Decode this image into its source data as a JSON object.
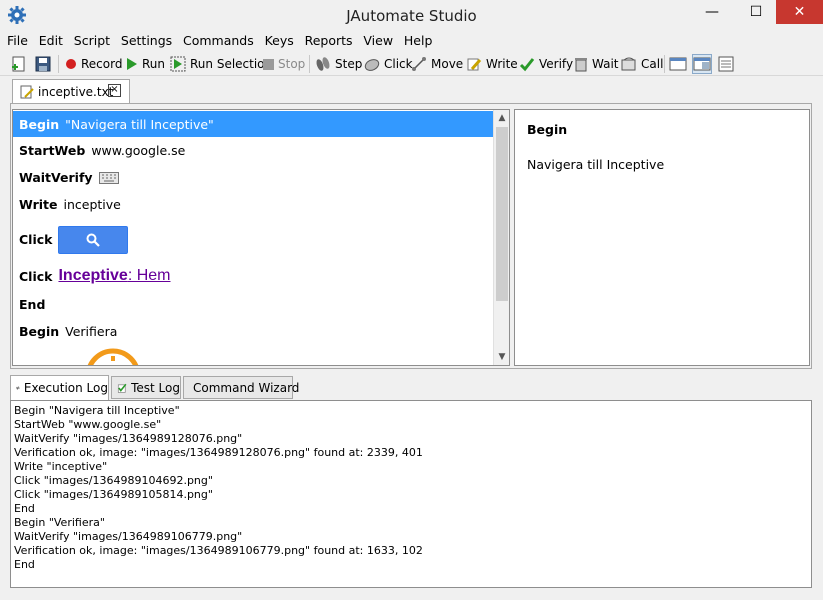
{
  "window": {
    "title": "JAutomate Studio",
    "minimize": "—",
    "maximize": "☐",
    "close": "✕"
  },
  "menu": [
    "File",
    "Edit",
    "Script",
    "Settings",
    "Commands",
    "Keys",
    "Reports",
    "View",
    "Help"
  ],
  "toolbar": {
    "record": "Record",
    "run": "Run",
    "run_selection": "Run Selection",
    "stop": "Stop",
    "step": "Step",
    "click": "Click",
    "move": "Move",
    "write": "Write",
    "verify": "Verify",
    "wait": "Wait",
    "call": "Call"
  },
  "file_tab": {
    "name": "inceptive.txt",
    "close": "×"
  },
  "script": {
    "lines": [
      {
        "keyword": "Begin",
        "arg": "\"Navigera till Inceptive\""
      },
      {
        "keyword": "StartWeb",
        "arg": "www.google.se"
      },
      {
        "keyword": "WaitVerify",
        "arg": ""
      },
      {
        "keyword": "Write",
        "arg": "inceptive"
      },
      {
        "keyword": "Click",
        "arg": ""
      },
      {
        "keyword": "Click",
        "arg": ""
      },
      {
        "keyword": "End",
        "arg": ""
      },
      {
        "keyword": "Begin",
        "arg": "Verifiera"
      }
    ],
    "link_image": {
      "bold": "Inceptive",
      "rest": ": Hem"
    }
  },
  "detail": {
    "title": "Begin",
    "text": "Navigera till Inceptive"
  },
  "bottom_tabs": {
    "execution_log": "Execution Log",
    "test_log": "Test Log",
    "command_wizard": "Command Wizard"
  },
  "log_lines": [
    "Begin \"Navigera till Inceptive\"",
    "StartWeb \"www.google.se\"",
    "WaitVerify \"images/1364989128076.png\"",
    "Verification ok, image: \"images/1364989128076.png\" found at: 2339, 401",
    "Write \"inceptive\"",
    "Click \"images/1364989104692.png\"",
    "Click \"images/1364989105814.png\"",
    "End",
    "Begin \"Verifiera\"",
    "WaitVerify \"images/1364989106779.png\"",
    "Verification ok, image: \"images/1364989106779.png\" found at: 1633, 102",
    "End"
  ],
  "colors": {
    "selection": "#3399ff",
    "close_button": "#c7372f",
    "google_blue": "#4787ed",
    "link_purple": "#660099"
  }
}
